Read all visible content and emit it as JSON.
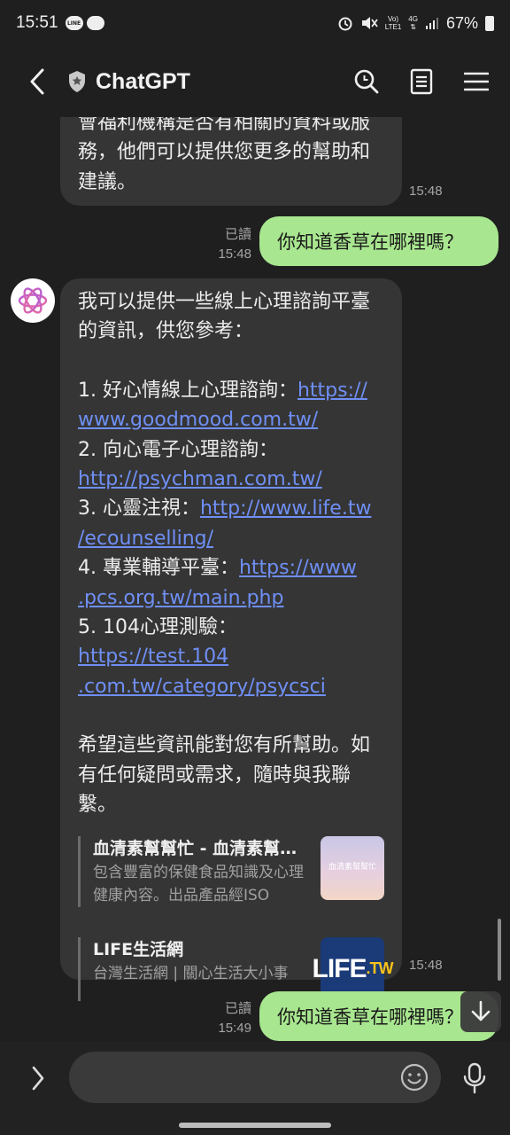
{
  "status_bar": {
    "time": "15:51",
    "line_badge": "LINE",
    "network_top": "Vo)",
    "network_bottom": "LTE1",
    "network_type": "4G",
    "battery": "67%"
  },
  "header": {
    "title": "ChatGPT"
  },
  "messages": {
    "bot_partial": {
      "lines": [
        "會福利機構是否有相關的資料或服",
        "務，他們可以提供您更多的幫助和",
        "建議。"
      ],
      "time": "15:48"
    },
    "user1": {
      "text": "你知道香草在哪裡嗎？",
      "read": "已讀",
      "time": "15:48"
    },
    "bot_main": {
      "intro": [
        "我可以提供一些線上心理諮詢平臺",
        "的資訊，供您參考："
      ],
      "items": [
        {
          "prefix": "1. 好心情線上心理諮詢：",
          "link1": "https://",
          "link2": "www.goodmood.com.tw/"
        },
        {
          "prefix": "2. 向心電子心理諮詢：",
          "link1": "",
          "link2": "http://psychman.com.tw/"
        },
        {
          "prefix": "3. 心靈注視：",
          "link1": "http://www.life.tw",
          "link2": "/ecounselling/"
        },
        {
          "prefix": "4. 專業輔導平臺：",
          "link1": "https://www",
          "link2": ".pcs.org.tw/main.php"
        },
        {
          "prefix": "5. 104心理測驗：",
          "link1": "https://test.104",
          "link2": ".com.tw/category/psycsci"
        }
      ],
      "outro": [
        "希望這些資訊能對您有所幫助。如",
        "有任何疑問或需求，隨時與我聯",
        "繫。"
      ],
      "previews": [
        {
          "title": "血清素幫幫忙 - 血清素幫幫忙",
          "desc": "包含豐富的保健食品知識及心理健康內容。出品產品經ISO",
          "thumb_text": "血清素幫幫忙"
        },
        {
          "title": "LIFE生活網",
          "desc": "台灣生活網 | 關心生活大小事",
          "thumb_text": "LIFE",
          "thumb_suffix": ".TW"
        }
      ],
      "time": "15:48"
    },
    "user2": {
      "text": "你知道香草在哪裡嗎？",
      "read": "已讀",
      "time": "15:49"
    }
  },
  "input": {
    "placeholder": ""
  }
}
